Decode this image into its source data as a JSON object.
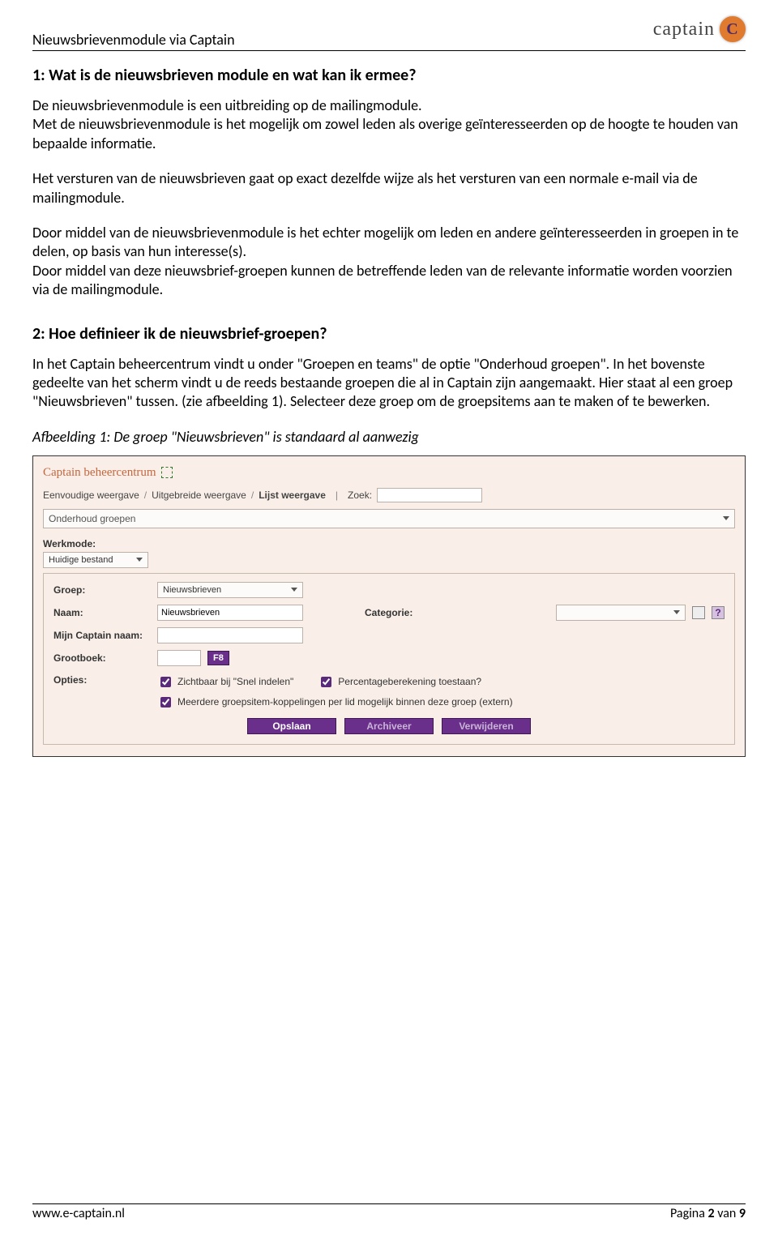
{
  "header": {
    "doc_title": "Nieuwsbrievenmodule via Captain",
    "logo_text": "captain",
    "logo_letter": "C"
  },
  "section1": {
    "heading": "1: Wat is de nieuwsbrieven module en wat kan ik ermee?",
    "p1": "De nieuwsbrievenmodule is een uitbreiding op de mailingmodule.",
    "p2": "Met de nieuwsbrievenmodule is het mogelijk om zowel leden als overige geïnteresseerden op de hoogte te houden van bepaalde informatie.",
    "p3": "Het versturen van de nieuwsbrieven gaat op exact dezelfde wijze als het versturen van een normale e-mail via de mailingmodule.",
    "p4": "Door middel van de nieuwsbrievenmodule is het echter mogelijk om leden en andere geïnteresseerden in groepen in te delen, op basis van hun interesse(s).",
    "p5": "Door middel van deze nieuwsbrief-groepen kunnen de betreffende leden van de relevante informatie worden voorzien via de mailingmodule."
  },
  "section2": {
    "heading": "2: Hoe definieer ik de nieuwsbrief-groepen?",
    "p1": "In het Captain beheercentrum vindt u onder \"Groepen en teams\" de optie \"Onderhoud groepen\". In het bovenste gedeelte van het scherm vindt u de reeds bestaande groepen die al in Captain zijn aangemaakt. Hier staat al een groep \"Nieuwsbrieven\" tussen. (zie afbeelding 1). Selecteer deze groep om de groepsitems aan te maken of te bewerken.",
    "caption": "Afbeelding 1: De groep \"Nieuwsbrieven\" is standaard al aanwezig"
  },
  "ui": {
    "title": "Captain beheercentrum",
    "viewbar": {
      "simple": "Eenvoudige weergave",
      "extended": "Uitgebreide weergave",
      "list": "Lijst weergave",
      "search_label": "Zoek:"
    },
    "page_select": "Onderhoud groepen",
    "workmode_label": "Werkmode:",
    "workmode_value": "Huidige bestand",
    "group_label": "Groep:",
    "group_value": "Nieuwsbrieven",
    "name_label": "Naam:",
    "name_value": "Nieuwsbrieven",
    "cat_label": "Categorie:",
    "mijn_label": "Mijn Captain naam:",
    "grootboek_label": "Grootboek:",
    "f8": "F8",
    "opties_label": "Opties:",
    "opt1": "Zichtbaar bij \"Snel indelen\"",
    "opt2": "Percentageberekening toestaan?",
    "opt3": "Meerdere groepsitem-koppelingen per lid mogelijk binnen deze groep (extern)",
    "btn_save": "Opslaan",
    "btn_archive": "Archiveer",
    "btn_delete": "Verwijderen"
  },
  "footer": {
    "url": "www.e-captain.nl",
    "page_prefix": "Pagina ",
    "page_num": "2",
    "page_suffix": " van ",
    "page_total": "9"
  }
}
